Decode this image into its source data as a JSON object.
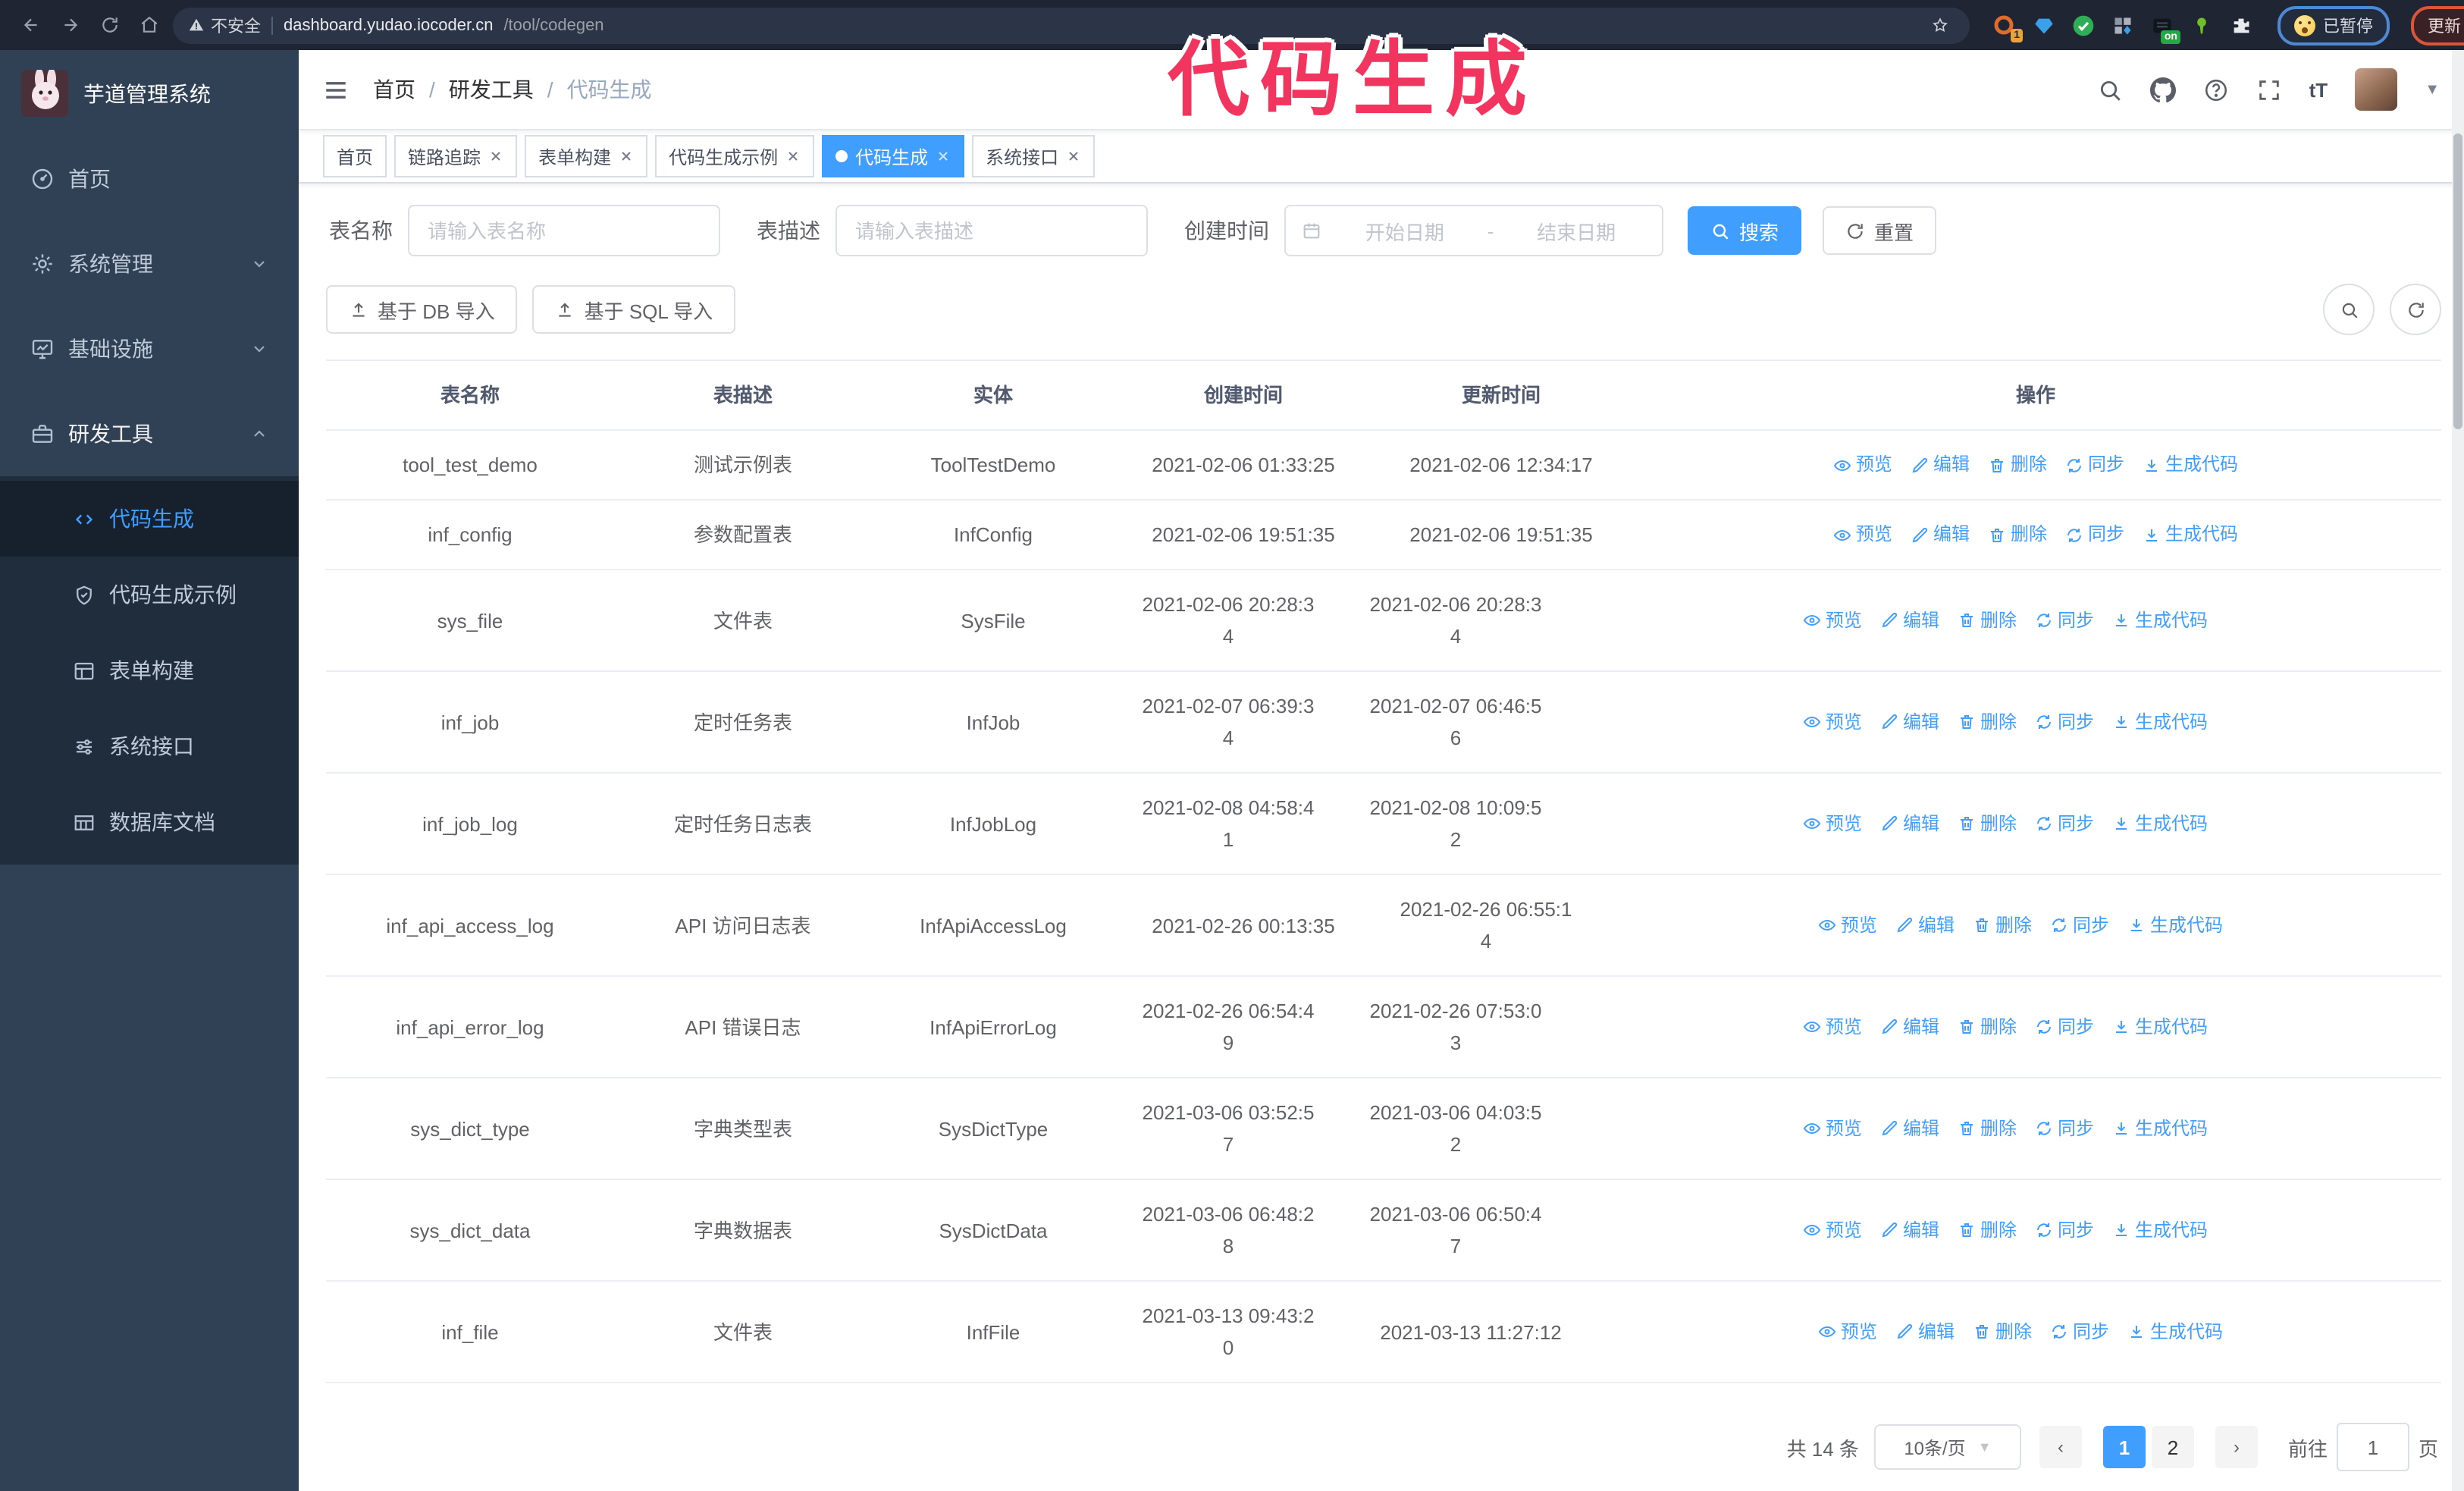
{
  "browser": {
    "security_label": "不安全",
    "url_host": "dashboard.yudao.iocoder.cn",
    "url_path": "/tool/codegen",
    "extension_badge": "1",
    "extension_on_badge": "on",
    "paused_label": "已暂停",
    "update_label": "更新",
    "menu_dots": "⋮"
  },
  "annotation": {
    "text": "代码生成",
    "color": "#f2355f"
  },
  "sidebar": {
    "title": "芋道管理系统",
    "items": [
      {
        "label": "首页"
      },
      {
        "label": "系统管理"
      },
      {
        "label": "基础设施"
      },
      {
        "label": "研发工具"
      }
    ],
    "subitems": [
      {
        "label": "代码生成",
        "active": true
      },
      {
        "label": "代码生成示例"
      },
      {
        "label": "表单构建"
      },
      {
        "label": "系统接口"
      },
      {
        "label": "数据库文档"
      }
    ]
  },
  "navbar": {
    "breadcrumb": {
      "0": "首页",
      "1": "研发工具",
      "2": "代码生成"
    }
  },
  "tabs": [
    {
      "label": "首页",
      "closable": false,
      "active": false
    },
    {
      "label": "链路追踪",
      "closable": true,
      "active": false
    },
    {
      "label": "表单构建",
      "closable": true,
      "active": false
    },
    {
      "label": "代码生成示例",
      "closable": true,
      "active": false
    },
    {
      "label": "代码生成",
      "closable": true,
      "active": true
    },
    {
      "label": "系统接口",
      "closable": true,
      "active": false
    }
  ],
  "search": {
    "name_label": "表名称",
    "name_placeholder": "请输入表名称",
    "desc_label": "表描述",
    "desc_placeholder": "请输入表描述",
    "time_label": "创建时间",
    "start_placeholder": "开始日期",
    "range_separator": "-",
    "end_placeholder": "结束日期",
    "search_button": "搜索",
    "reset_button": "重置"
  },
  "toolbar": {
    "import_db": "基于 DB 导入",
    "import_sql": "基于 SQL 导入"
  },
  "table": {
    "headers": [
      "表名称",
      "表描述",
      "实体",
      "创建时间",
      "更新时间",
      "操作"
    ],
    "actions": [
      "预览",
      "编辑",
      "删除",
      "同步",
      "生成代码"
    ],
    "rows": [
      {
        "name": "tool_test_demo",
        "desc": "测试示例表",
        "entity": "ToolTestDemo",
        "created": "2021-02-06 01:33:25",
        "updated": "2021-02-06 12:34:17"
      },
      {
        "name": "inf_config",
        "desc": "参数配置表",
        "entity": "InfConfig",
        "created": "2021-02-06 19:51:35",
        "updated": "2021-02-06 19:51:35"
      },
      {
        "name": "sys_file",
        "desc": "文件表",
        "entity": "SysFile",
        "created": "2021-02-06 20:28:34",
        "updated": "2021-02-06 20:28:34"
      },
      {
        "name": "inf_job",
        "desc": "定时任务表",
        "entity": "InfJob",
        "created": "2021-02-07 06:39:34",
        "updated": "2021-02-07 06:46:56"
      },
      {
        "name": "inf_job_log",
        "desc": "定时任务日志表",
        "entity": "InfJobLog",
        "created": "2021-02-08 04:58:41",
        "updated": "2021-02-08 10:09:52"
      },
      {
        "name": "inf_api_access_log",
        "desc": "API 访问日志表",
        "entity": "InfApiAccessLog",
        "created": "2021-02-26 00:13:35",
        "updated": "2021-02-26 06:55:14"
      },
      {
        "name": "inf_api_error_log",
        "desc": "API 错误日志",
        "entity": "InfApiErrorLog",
        "created": "2021-02-26 06:54:49",
        "updated": "2021-02-26 07:53:03"
      },
      {
        "name": "sys_dict_type",
        "desc": "字典类型表",
        "entity": "SysDictType",
        "created": "2021-03-06 03:52:57",
        "updated": "2021-03-06 04:03:52"
      },
      {
        "name": "sys_dict_data",
        "desc": "字典数据表",
        "entity": "SysDictData",
        "created": "2021-03-06 06:48:28",
        "updated": "2021-03-06 06:50:47"
      },
      {
        "name": "inf_file",
        "desc": "文件表",
        "entity": "InfFile",
        "created": "2021-03-13 09:43:20",
        "updated": "2021-03-13 11:27:12"
      }
    ]
  },
  "pagination": {
    "total": "共 14 条",
    "page_size": "10条/页",
    "pages": [
      "1",
      "2"
    ],
    "current": "1",
    "goto_label": "前往",
    "goto_value": "1",
    "page_unit": "页"
  }
}
